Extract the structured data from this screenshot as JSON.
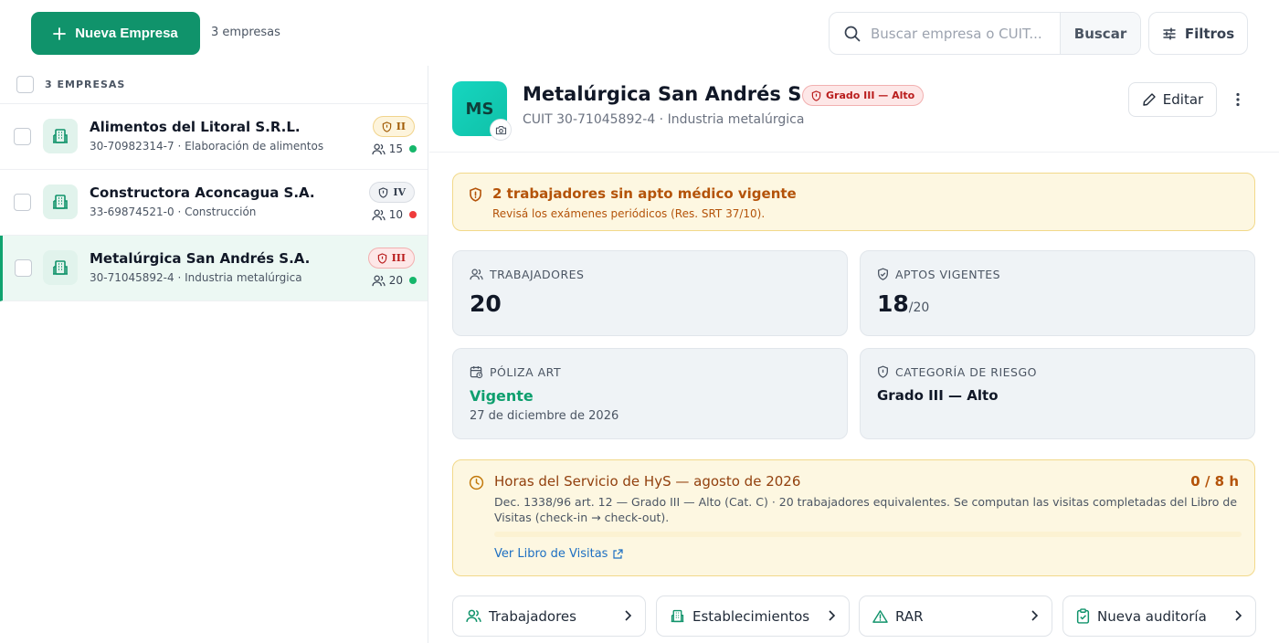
{
  "toolbar": {
    "new_button_label": "Nueva Empresa",
    "count_label": "3 empresas",
    "search_placeholder": "Buscar empresa o CUIT...",
    "search_button_label": "Buscar",
    "filters_label": "Filtros"
  },
  "list": {
    "header": "3 EMPRESAS",
    "items": [
      {
        "name": "Alimentos del Litoral S.R.L.",
        "sub": "30-70982314-7 · Elaboración de alimentos",
        "grade": "II",
        "grade_style": "yellow",
        "workers": "15",
        "status_color": "#16b76b",
        "selected": false
      },
      {
        "name": "Constructora Aconcagua S.A.",
        "sub": "33-69874521-0 · Construcción",
        "grade": "IV",
        "grade_style": "gray",
        "workers": "10",
        "status_color": "#ef3b3b",
        "selected": false
      },
      {
        "name": "Metalúrgica San Andrés S.A.",
        "sub": "30-71045892-4 · Industria metalúrgica",
        "grade": "III",
        "grade_style": "red",
        "workers": "20",
        "status_color": "#16b76b",
        "selected": true
      }
    ]
  },
  "detail": {
    "avatar_initials": "MS",
    "title": "Metalúrgica San Andrés S.A.",
    "risk_badge": "Grado III — Alto",
    "subtitle": "CUIT 30-71045892-4 · Industria metalúrgica",
    "edit_label": "Editar",
    "alert": {
      "title": "2 trabajadores sin apto médico vigente",
      "text": "Revisá los exámenes periódicos (Res. SRT 37/10)."
    },
    "stats": {
      "workers": {
        "label": "TRABAJADORES",
        "value": "20"
      },
      "aptos": {
        "label": "APTOS VIGENTES",
        "value": "18",
        "total": "/20"
      },
      "poliza": {
        "label": "PÓLIZA ART",
        "status": "Vigente",
        "date": "27 de diciembre de 2026"
      },
      "risk": {
        "label": "CATEGORÍA DE RIESGO",
        "value": "Grado III — Alto"
      }
    },
    "hours": {
      "title": "Horas del Servicio de HyS — agosto de 2026",
      "value": "0 / 8 h",
      "progress": 0,
      "description": "Dec. 1338/96 art. 12 — Grado III — Alto (Cat. C) · 20 trabajadores equivalentes. Se computan las visitas completadas del Libro de Visitas (check-in → check-out).",
      "link_label": "Ver Libro de Visitas"
    },
    "nav": [
      {
        "label": "Trabajadores",
        "icon": "users-icon"
      },
      {
        "label": "Establecimientos",
        "icon": "building-icon"
      },
      {
        "label": "RAR",
        "icon": "warning-icon"
      },
      {
        "label": "Nueva auditoría",
        "icon": "clipboard-check-icon"
      }
    ]
  },
  "colors": {
    "accent": "#10936b",
    "warning_bg": "#fdf7e1",
    "danger": "#b91c1c"
  }
}
